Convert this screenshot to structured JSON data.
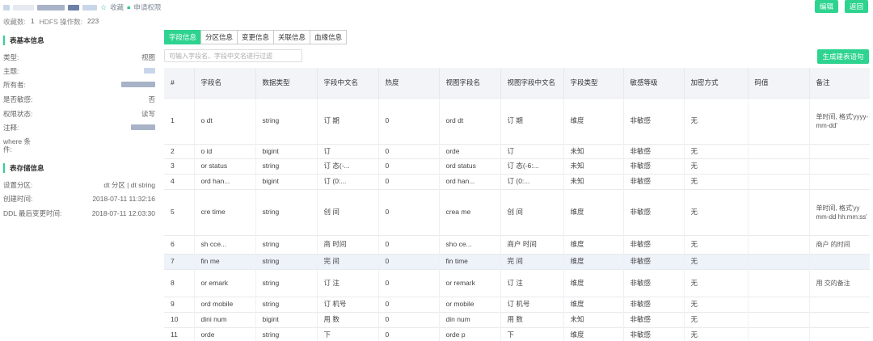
{
  "header": {
    "fav_label": "收藏",
    "perm_label": "申请权限",
    "stats_fav_label": "收藏数:",
    "stats_fav_value": "1",
    "stats_hdfs_label": "HDFS 操作数:",
    "stats_hdfs_value": "223",
    "edit_label": "编辑",
    "back_label": "返回"
  },
  "basic": {
    "title": "表基本信息",
    "rows": [
      {
        "k": "类型:",
        "v": "视图"
      },
      {
        "k": "主题:",
        "v": ""
      },
      {
        "k": "所有者:",
        "v": ""
      },
      {
        "k": "是否敏感:",
        "v": "否"
      },
      {
        "k": "权限状态:",
        "v": "读写"
      },
      {
        "k": "注释:",
        "v": ""
      }
    ],
    "where_label": "where 条件:"
  },
  "storage": {
    "title": "表存储信息",
    "rows": [
      {
        "k": "设置分区:",
        "v": "dt 分区 | dt string"
      },
      {
        "k": "创建时间:",
        "v": "2018-07-11 11:32:16"
      },
      {
        "k": "DDL 最后变更时间:",
        "v": "2018-07-11 12:03:30"
      }
    ]
  },
  "tabs": [
    "字段信息",
    "分区信息",
    "变更信息",
    "关联信息",
    "血缘信息"
  ],
  "filter": {
    "placeholder": "可输入字段名、字段中文名进行过滤"
  },
  "generate_label": "生成建表语句",
  "table": {
    "headers": [
      "#",
      "字段名",
      "数据类型",
      "字段中文名",
      "热度",
      "视图字段名",
      "视图字段中文名",
      "字段类型",
      "敏感等级",
      "加密方式",
      "码值",
      "备注"
    ],
    "rows": [
      {
        "n": "1",
        "name": "o    dt",
        "type": "string",
        "cn": "订    期",
        "hot": "0",
        "vname": "ord     dt",
        "vcn": "订    期",
        "ftype": "维度",
        "sens": "非敏感",
        "enc": "无",
        "code": "",
        "note": "      单时间,    格式'yyyy-mm-dd'"
      },
      {
        "n": "2",
        "name": "o    id",
        "type": "bigint",
        "cn": "订",
        "hot": "0",
        "vname": "orde",
        "vcn": "订",
        "ftype": "未知",
        "sens": "非敏感",
        "enc": "无",
        "code": "",
        "note": ""
      },
      {
        "n": "3",
        "name": "or     status",
        "type": "string",
        "cn": "订    态(-...",
        "hot": "0",
        "vname": "ord    status",
        "vcn": "订    态(-6:...",
        "ftype": "未知",
        "sens": "非敏感",
        "enc": "无",
        "code": "",
        "note": ""
      },
      {
        "n": "4",
        "name": "ord    han...",
        "type": "bigint",
        "cn": "订    (0:...",
        "hot": "0",
        "vname": "ord    han...",
        "vcn": "订    (0:...",
        "ftype": "未知",
        "sens": "非敏感",
        "enc": "无",
        "code": "",
        "note": ""
      },
      {
        "n": "5",
        "name": "cre    time",
        "type": "string",
        "cn": "创    间",
        "hot": "0",
        "vname": "crea    me",
        "vcn": "创    间",
        "ftype": "维度",
        "sens": "非敏感",
        "enc": "无",
        "code": "",
        "note": "   单时间,    格式'yy    mm-dd hh:mm:ss'"
      },
      {
        "n": "6",
        "name": "sh    cce...",
        "type": "string",
        "cn": "商    时间",
        "hot": "0",
        "vname": "sho    ce...",
        "vcn": "商户    时间",
        "ftype": "维度",
        "sens": "非敏感",
        "enc": "无",
        "code": "",
        "note": "商户    的时间"
      },
      {
        "n": "7",
        "name": "fin    me",
        "type": "string",
        "cn": "完    间",
        "hot": "0",
        "vname": "fin    time",
        "vcn": "完    间",
        "ftype": "维度",
        "sens": "非敏感",
        "enc": "无",
        "code": "",
        "note": ""
      },
      {
        "n": "8",
        "name": "or    emark",
        "type": "string",
        "cn": "订    注",
        "hot": "0",
        "vname": "or    remark",
        "vcn": "订    注",
        "ftype": "维度",
        "sens": "非敏感",
        "enc": "无",
        "code": "",
        "note": "用    交的备注"
      },
      {
        "n": "9",
        "name": "ord    mobile",
        "type": "string",
        "cn": "订    机号",
        "hot": "0",
        "vname": "or    mobile",
        "vcn": "订    机号",
        "ftype": "维度",
        "sens": "非敏感",
        "enc": "无",
        "code": "",
        "note": ""
      },
      {
        "n": "10",
        "name": "dini    num",
        "type": "bigint",
        "cn": "用    数",
        "hot": "0",
        "vname": "din    num",
        "vcn": "用    数",
        "ftype": "未知",
        "sens": "非敏感",
        "enc": "无",
        "code": "",
        "note": ""
      },
      {
        "n": "11",
        "name": "orde",
        "type": "string",
        "cn": "下",
        "hot": "0",
        "vname": "orde    p",
        "vcn": "下    ",
        "ftype": "维度",
        "sens": "非敏感",
        "enc": "无",
        "code": "",
        "note": ""
      }
    ]
  }
}
